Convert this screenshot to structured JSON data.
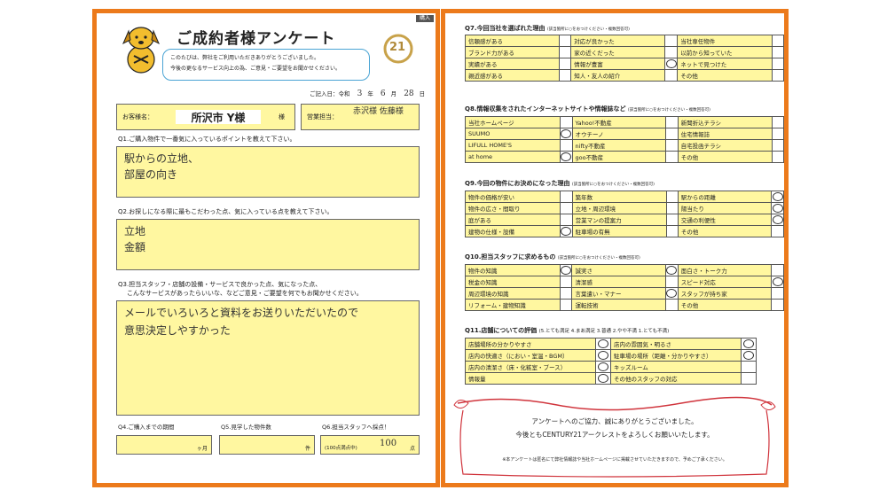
{
  "badge": "購入",
  "title": "ご成約者様アンケート",
  "logo_text": "21",
  "intro_lines": [
    "このたびは、弊社をご利用いただきありがとうございました。",
    "今後の更なるサービス向上の為、ご意見・ご要望をお聞かせください。"
  ],
  "date": {
    "label": "ご記入日：令和",
    "year": "3",
    "y_unit": "年",
    "month": "6",
    "m_unit": "月",
    "day": "28",
    "d_unit": "日"
  },
  "customer": {
    "label": "お客様名：",
    "name": "所沢市 Y様",
    "suffix": "様"
  },
  "staff": {
    "label": "営業担当：",
    "value": "赤沢様 佐藤様"
  },
  "q1": {
    "label": "Q1.ご購入物件で一番気に入っているポイントを教えて下さい。",
    "answer": [
      "駅からの立地、",
      "部屋の向き"
    ]
  },
  "q2": {
    "label": "Q2.お探しになる際に最もこだわった点、気に入っている点を教えて下さい。",
    "answer": [
      "立地",
      "金額"
    ]
  },
  "q3": {
    "label1": "Q3.担当スタッフ・店舗の設備・サービスで良かった点、気になった点、",
    "label2": "こんなサービスがあったらいいな、などご意見・ご要望を何でもお聞かせください。",
    "answer": [
      "メールでいろいろと資料をお送りいただいたので",
      "意思決定しやすかった"
    ]
  },
  "q4": {
    "label": "Q4.ご購入までの期間",
    "unit": "ヶ月",
    "value": ""
  },
  "q5": {
    "label": "Q5.見学した物件数",
    "unit": "件",
    "value": ""
  },
  "q6": {
    "label": "Q6.担当スタッフへ採点！",
    "note": "(100点満点中)",
    "value": "100",
    "unit": "点"
  },
  "q7": {
    "label": "Q7.今回当社を選ばれた理由",
    "note": "(該当箇所に○をおつけください・複数回答可)",
    "rows": [
      [
        "信頼感がある",
        "",
        "対応が良かった",
        "",
        "当社専任物件",
        ""
      ],
      [
        "ブランド力がある",
        "",
        "家の近くだった",
        "",
        "以前から知っていた",
        ""
      ],
      [
        "実績がある",
        "",
        "情報が豊富",
        "○",
        "ネットで見つけた",
        ""
      ],
      [
        "親近感がある",
        "",
        "知人・友人の紹介",
        "",
        "その他",
        ""
      ]
    ]
  },
  "q8": {
    "label": "Q8.情報収集をされたインターネットサイトや情報誌など",
    "note": "(該当箇所に○をおつけください・複数回答可)",
    "rows": [
      [
        "当社ホームページ",
        "",
        "Yahoo!不動産",
        "",
        "新聞折込チラシ",
        ""
      ],
      [
        "SUUMO",
        "○",
        "オウチーノ",
        "",
        "住宅情報誌",
        ""
      ],
      [
        "LIFULL HOME'S",
        "",
        "nifty不動産",
        "",
        "自宅投函チラシ",
        ""
      ],
      [
        "at home",
        "○",
        "goo不動産",
        "",
        "その他",
        ""
      ]
    ]
  },
  "q9": {
    "label": "Q9.今回の物件にお決めになった理由",
    "note": "(該当箇所に○をおつけください・複数回答可)",
    "rows": [
      [
        "物件の価格が安い",
        "",
        "築年数",
        "",
        "駅からの距離",
        "○"
      ],
      [
        "物件の広さ・間取り",
        "",
        "立地・周辺環境",
        "",
        "陽当たり",
        "○"
      ],
      [
        "庭がある",
        "",
        "営業マンの提案力",
        "",
        "交通の利便性",
        "○"
      ],
      [
        "建物の仕様・設備",
        "○",
        "駐車場の有無",
        "",
        "その他",
        ""
      ]
    ]
  },
  "q10": {
    "label": "Q10.担当スタッフに求めるもの",
    "note": "(該当箇所に○をおつけください・複数回答可)",
    "rows": [
      [
        "物件の知識",
        "○",
        "誠実さ",
        "○",
        "面白さ・トーク力",
        ""
      ],
      [
        "税金の知識",
        "",
        "清潔感",
        "",
        "スピード対応",
        "○"
      ],
      [
        "周辺環境の知識",
        "",
        "言葉遣い・マナー",
        "○",
        "スタッフが持ち家",
        ""
      ],
      [
        "リフォーム・建物知識",
        "",
        "運転技術",
        "",
        "その他",
        ""
      ]
    ]
  },
  "q11": {
    "label": "Q11.店舗についての評価",
    "scale": "(5.とても満足 4.まあ満足 3.普通 2.やや不満 1.とても不満)",
    "rows": [
      [
        "店舗場所の分かりやすさ",
        "○",
        "店内の雰囲気・明るさ",
        "○"
      ],
      [
        "店内の快適さ（におい・室温・BGM）",
        "○",
        "駐車場の場所（距離・分かりやすさ）",
        "○"
      ],
      [
        "店内の清潔さ（床・化粧室・ブース）",
        "○",
        "キッズルーム",
        ""
      ],
      [
        "情報量",
        "○",
        "その他のスタッフの対応",
        ""
      ]
    ]
  },
  "thanks": {
    "line1": "アンケートへのご協力、誠にありがとうございました。",
    "line2": "今後ともCENTURY21アークレストをよろしくお願いいたします。",
    "note": "※本アンケートは匿名にて弊社情報誌や当社ホームページに掲載させていただきますので、予めご了承ください。"
  }
}
